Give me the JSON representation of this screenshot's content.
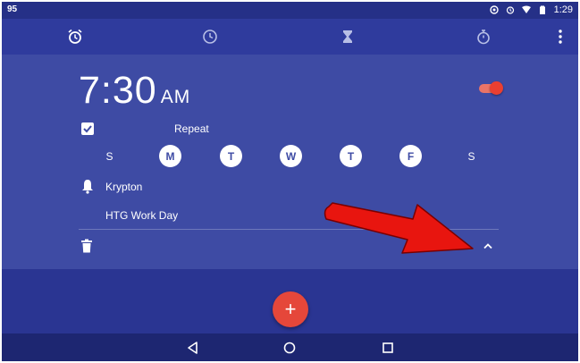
{
  "status_bar": {
    "left_text": "95",
    "time": "1:29",
    "icons": [
      "sync-icon",
      "alarm-icon",
      "wifi-icon",
      "battery-icon"
    ]
  },
  "tabs": [
    {
      "name": "alarm-tab",
      "icon": "alarm-clock-icon",
      "active": true
    },
    {
      "name": "clock-tab",
      "icon": "clock-icon",
      "active": false
    },
    {
      "name": "timer-tab",
      "icon": "hourglass-icon",
      "active": false
    },
    {
      "name": "stopwatch-tab",
      "icon": "stopwatch-icon",
      "active": false
    }
  ],
  "alarm": {
    "time": "7:30",
    "ampm": "AM",
    "enabled": true,
    "repeat_label": "Repeat",
    "repeat_checked": true,
    "days": [
      {
        "label": "S",
        "on": false
      },
      {
        "label": "M",
        "on": true
      },
      {
        "label": "T",
        "on": true
      },
      {
        "label": "W",
        "on": true
      },
      {
        "label": "T",
        "on": true
      },
      {
        "label": "F",
        "on": true
      },
      {
        "label": "S",
        "on": false
      }
    ],
    "ringtone": "Krypton",
    "label": "HTG Work Day"
  },
  "colors": {
    "background": "#2a3592",
    "card": "#3e4ba4",
    "accent": "#e5473a",
    "annotation_arrow": "#e8150f"
  },
  "fab": {
    "label": "+"
  },
  "nav": {
    "buttons": [
      "back-icon",
      "home-icon",
      "recents-icon"
    ]
  }
}
